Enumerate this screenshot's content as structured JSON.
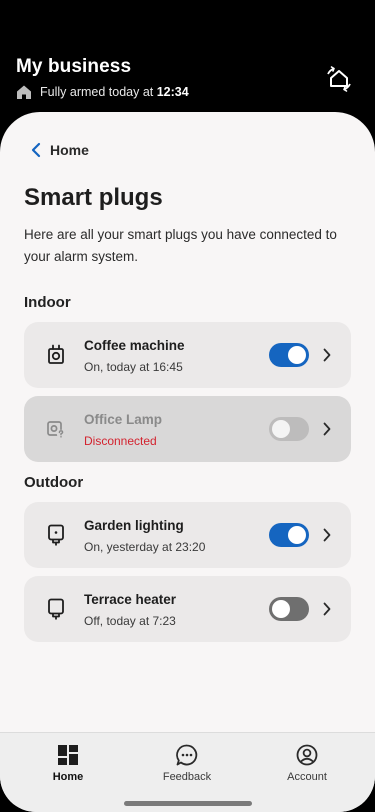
{
  "header": {
    "title": "My business",
    "status_prefix": "Fully armed today at ",
    "status_time": "12:34"
  },
  "nav": {
    "back_label": "Home"
  },
  "page": {
    "title": "Smart plugs",
    "description": "Here are all your smart plugs you have connected to your alarm system."
  },
  "sections": {
    "indoor": "Indoor",
    "outdoor": "Outdoor"
  },
  "devices": [
    {
      "name": "Coffee machine",
      "status": "On, today at 16:45",
      "state": "on",
      "icon": "coffee-machine-icon"
    },
    {
      "name": "Office Lamp",
      "status": "Disconnected",
      "state": "disconnected",
      "icon": "plug-unknown-icon"
    },
    {
      "name": "Garden lighting",
      "status": "On, yesterday at 23:20",
      "state": "on",
      "icon": "outdoor-plug-icon"
    },
    {
      "name": "Terrace heater",
      "status": "Off, today at 7:23",
      "state": "off",
      "icon": "outdoor-plug-icon"
    }
  ],
  "tabs": [
    {
      "label": "Home",
      "icon": "dashboard-icon",
      "active": true
    },
    {
      "label": "Feedback",
      "icon": "chat-bubble-icon",
      "active": false
    },
    {
      "label": "Account",
      "icon": "user-circle-icon",
      "active": false
    }
  ],
  "colors": {
    "toggle_on": "#1565c0",
    "toggle_off": "#6f6f6f",
    "disconnected_text": "#d3232f",
    "background": "#f8f6f6"
  }
}
